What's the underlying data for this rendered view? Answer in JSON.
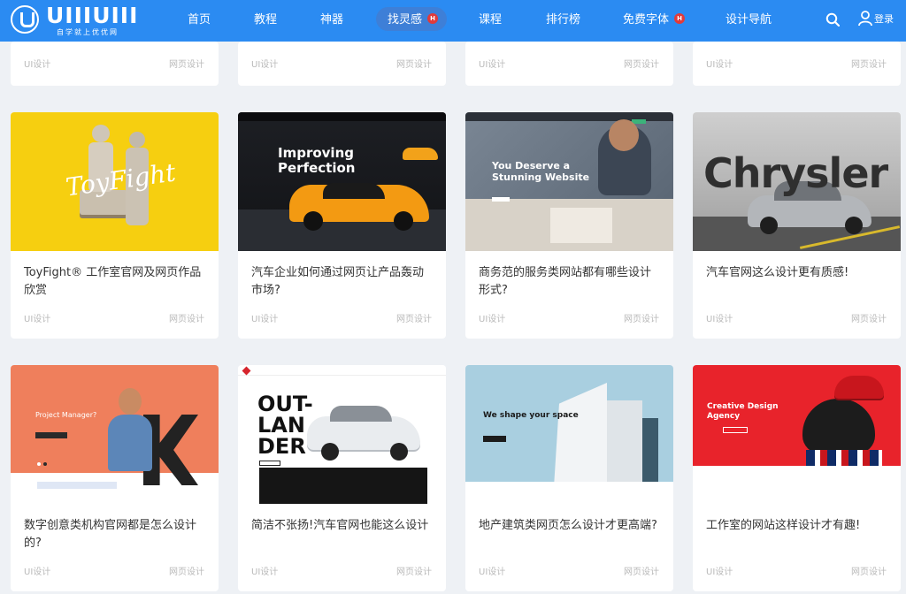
{
  "brand": {
    "name": "UIIIUIII",
    "slogan": "自学就上优优网"
  },
  "nav": {
    "items": [
      "首页",
      "教程",
      "神器",
      "找灵感",
      "课程",
      "排行榜",
      "免费字体",
      "设计导航"
    ],
    "hot_badge": "H",
    "login": "登录"
  },
  "top_row": [
    {
      "tag_left": "UI设计",
      "tag_right": "网页设计"
    },
    {
      "tag_left": "UI设计",
      "tag_right": "网页设计"
    },
    {
      "tag_left": "UI设计",
      "tag_right": "网页设计"
    },
    {
      "tag_left": "UI设计",
      "tag_right": "网页设计"
    }
  ],
  "cards": [
    {
      "title": "ToyFight® 工作室官网及网页作品欣赏",
      "tag_left": "UI设计",
      "tag_right": "网页设计",
      "thumb_text": "ToyFight"
    },
    {
      "title": "汽车企业如何通过网页让产品轰动市场?",
      "tag_left": "UI设计",
      "tag_right": "网页设计",
      "thumb_text": "Improving Perfection"
    },
    {
      "title": "商务范的服务类网站都有哪些设计形式?",
      "tag_left": "UI设计",
      "tag_right": "网页设计",
      "thumb_text": "You Deserve a Stunning Website"
    },
    {
      "title": "汽车官网这么设计更有质感!",
      "tag_left": "UI设计",
      "tag_right": "网页设计",
      "thumb_text": "Chrysler"
    },
    {
      "title": "数字创意类机构官网都是怎么设计的?",
      "tag_left": "UI设计",
      "tag_right": "网页设计",
      "thumb_text": "Project Manager?"
    },
    {
      "title": "简洁不张扬!汽车官网也能这么设计",
      "tag_left": "UI设计",
      "tag_right": "网页设计",
      "thumb_text": "OUT-LANDER"
    },
    {
      "title": "地产建筑类网页怎么设计才更高端?",
      "tag_left": "UI设计",
      "tag_right": "网页设计",
      "thumb_text": "We shape your space"
    },
    {
      "title": "工作室的网站这样设计才有趣!",
      "tag_left": "UI设计",
      "tag_right": "网页设计",
      "thumb_text": "Creative Design Agency"
    }
  ],
  "colors": {
    "header": "#2b8bf2",
    "background": "#eef1f5",
    "hot": "#e23a3a"
  }
}
